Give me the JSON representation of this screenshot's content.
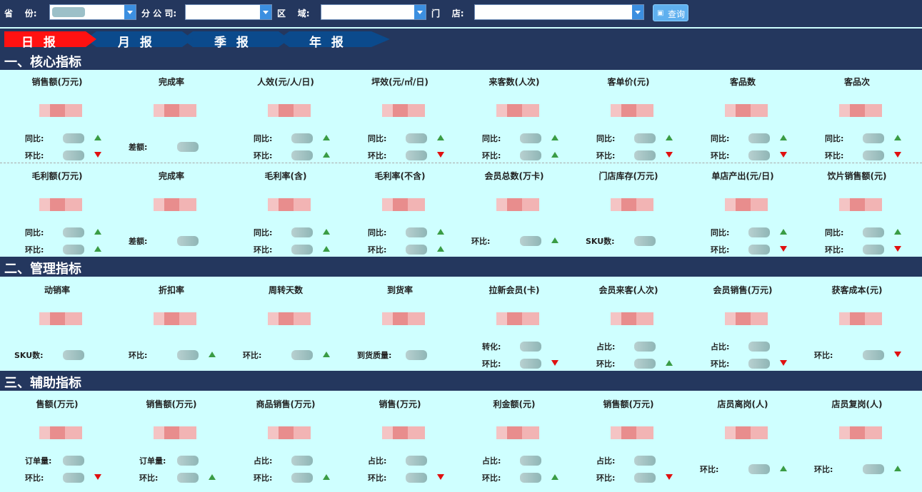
{
  "filters": {
    "province_label": "省    份:",
    "branch_label": "分 公 司:",
    "region_label": "区    域:",
    "store_label": "门    店:",
    "query_button": "查询"
  },
  "tabs": [
    "日 报",
    "月 报",
    "季 报",
    "年 报"
  ],
  "active_tab": "日 报",
  "colors": {
    "header": "#24375e",
    "panel": "#cfffff",
    "active_tab": "#ff1111",
    "up": "#3a9c45",
    "down": "#e01010"
  },
  "sections": [
    {
      "title": "一、核心指标",
      "rows": [
        [
          {
            "title": "销售额(万元)",
            "metrics": [
              {
                "label": "同比:",
                "dir": "up"
              },
              {
                "label": "环比:",
                "dir": "down"
              }
            ]
          },
          {
            "title": "完成率",
            "metrics": [
              {
                "label": "差额:",
                "dir": ""
              }
            ]
          },
          {
            "title": "人效(元/人/日)",
            "metrics": [
              {
                "label": "同比:",
                "dir": "up"
              },
              {
                "label": "环比:",
                "dir": "up"
              }
            ]
          },
          {
            "title": "坪效(元/㎡/日)",
            "metrics": [
              {
                "label": "同比:",
                "dir": "up"
              },
              {
                "label": "环比:",
                "dir": "down"
              }
            ]
          },
          {
            "title": "来客数(人次)",
            "metrics": [
              {
                "label": "同比:",
                "dir": "up"
              },
              {
                "label": "环比:",
                "dir": "up"
              }
            ]
          },
          {
            "title": "客单价(元)",
            "metrics": [
              {
                "label": "同比:",
                "dir": "up"
              },
              {
                "label": "环比:",
                "dir": "down"
              }
            ]
          },
          {
            "title": "客品数",
            "metrics": [
              {
                "label": "同比:",
                "dir": "up"
              },
              {
                "label": "环比:",
                "dir": "down"
              }
            ]
          },
          {
            "title": "客品次",
            "metrics": [
              {
                "label": "同比:",
                "dir": "up"
              },
              {
                "label": "环比:",
                "dir": "down"
              }
            ]
          }
        ],
        [
          {
            "title": "毛利额(万元)",
            "metrics": [
              {
                "label": "同比:",
                "dir": "up"
              },
              {
                "label": "环比:",
                "dir": "up"
              }
            ]
          },
          {
            "title": "完成率",
            "metrics": [
              {
                "label": "差额:",
                "dir": ""
              }
            ]
          },
          {
            "title": "毛利率(含)",
            "metrics": [
              {
                "label": "同比:",
                "dir": "up"
              },
              {
                "label": "环比:",
                "dir": "up"
              }
            ]
          },
          {
            "title": "毛利率(不含)",
            "metrics": [
              {
                "label": "同比:",
                "dir": "up"
              },
              {
                "label": "环比:",
                "dir": "up"
              }
            ]
          },
          {
            "title": "会员总数(万卡)",
            "metrics": [
              {
                "label": "环比:",
                "dir": "up"
              }
            ]
          },
          {
            "title": "门店库存(万元)",
            "metrics": [
              {
                "label": "SKU数:",
                "dir": ""
              }
            ]
          },
          {
            "title": "单店产出(元/日)",
            "metrics": [
              {
                "label": "同比:",
                "dir": "up"
              },
              {
                "label": "环比:",
                "dir": "down"
              }
            ]
          },
          {
            "title": "饮片销售额(元)",
            "metrics": [
              {
                "label": "同比:",
                "dir": "up"
              },
              {
                "label": "环比:",
                "dir": "down"
              }
            ]
          }
        ]
      ]
    },
    {
      "title": "二、管理指标",
      "rows": [
        [
          {
            "title": "动销率",
            "metrics": [
              {
                "label": "SKU数:",
                "dir": ""
              }
            ]
          },
          {
            "title": "折扣率",
            "metrics": [
              {
                "label": "环比:",
                "dir": "up"
              }
            ]
          },
          {
            "title": "周转天数",
            "metrics": [
              {
                "label": "环比:",
                "dir": "up"
              }
            ]
          },
          {
            "title": "到货率",
            "metrics": [
              {
                "label": "到货质量:",
                "dir": ""
              }
            ]
          },
          {
            "title": "拉新会员(卡)",
            "metrics": [
              {
                "label": "转化:",
                "dir": ""
              },
              {
                "label": "环比:",
                "dir": "down"
              }
            ]
          },
          {
            "title": "会员来客(人次)",
            "metrics": [
              {
                "label": "占比:",
                "dir": ""
              },
              {
                "label": "环比:",
                "dir": "up"
              }
            ]
          },
          {
            "title": "会员销售(万元)",
            "metrics": [
              {
                "label": "占比:",
                "dir": ""
              },
              {
                "label": "环比:",
                "dir": "down"
              }
            ]
          },
          {
            "title": "获客成本(元)",
            "metrics": [
              {
                "label": "环比:",
                "dir": "down"
              }
            ]
          }
        ]
      ]
    },
    {
      "title": "三、辅助指标",
      "rows": [
        [
          {
            "title": "售额(万元)",
            "metrics": [
              {
                "label": "订单量:",
                "dir": ""
              },
              {
                "label": "环比:",
                "dir": "down"
              }
            ]
          },
          {
            "title": "销售额(万元)",
            "metrics": [
              {
                "label": "订单量:",
                "dir": ""
              },
              {
                "label": "环比:",
                "dir": "up"
              }
            ]
          },
          {
            "title": "商品销售(万元)",
            "metrics": [
              {
                "label": "占比:",
                "dir": ""
              },
              {
                "label": "环比:",
                "dir": "up"
              }
            ]
          },
          {
            "title": "销售(万元)",
            "metrics": [
              {
                "label": "占比:",
                "dir": ""
              },
              {
                "label": "环比:",
                "dir": "down"
              }
            ]
          },
          {
            "title": "利金额(元)",
            "metrics": [
              {
                "label": "占比:",
                "dir": ""
              },
              {
                "label": "环比:",
                "dir": "up"
              }
            ]
          },
          {
            "title": "销售额(万元)",
            "metrics": [
              {
                "label": "占比:",
                "dir": ""
              },
              {
                "label": "环比:",
                "dir": "down"
              }
            ]
          },
          {
            "title": "店员离岗(人)",
            "metrics": [
              {
                "label": "环比:",
                "dir": "up"
              }
            ]
          },
          {
            "title": "店员复岗(人)",
            "metrics": [
              {
                "label": "环比:",
                "dir": "up"
              }
            ]
          }
        ]
      ]
    }
  ]
}
